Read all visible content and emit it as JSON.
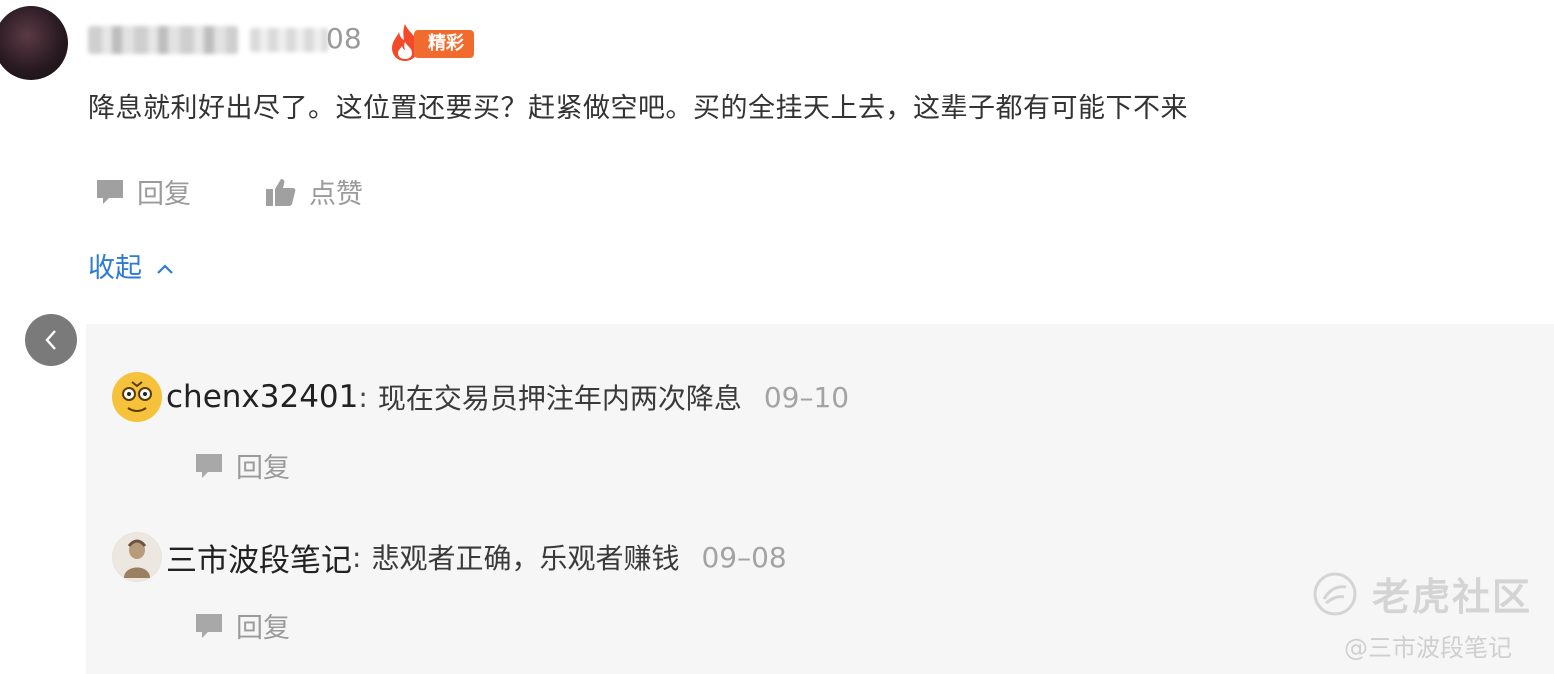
{
  "comment": {
    "date_suffix": "08",
    "featured_badge": "精彩",
    "text": "降息就利好出尽了。这位置还要买？赶紧做空吧。买的全挂天上去，这辈子都有可能下不来",
    "reply_label": "回复",
    "like_label": "点赞",
    "collapse_label": "收起"
  },
  "replies": [
    {
      "user": "chenx32401",
      "colon": ":",
      "text": "现在交易员押注年内两次降息",
      "date": "09–10",
      "reply_label": "回复"
    },
    {
      "user": "三市波段笔记",
      "colon": ":",
      "text": "悲观者正确，乐观者赚钱",
      "date": "09–08",
      "reply_label": "回复"
    }
  ],
  "watermark": {
    "brand": "老虎社区",
    "handle": "@三市波段笔记"
  },
  "colors": {
    "link_blue": "#2e7bd6",
    "badge_orange": "#f26b2e",
    "panel_bg": "#f6f6f7",
    "muted_gray": "#9b9b9b"
  },
  "icons": [
    "comment-bubble-icon",
    "thumbs-up-icon",
    "chevron-up-icon",
    "chevron-left-icon",
    "flame-icon",
    "tiger-logo-icon"
  ]
}
